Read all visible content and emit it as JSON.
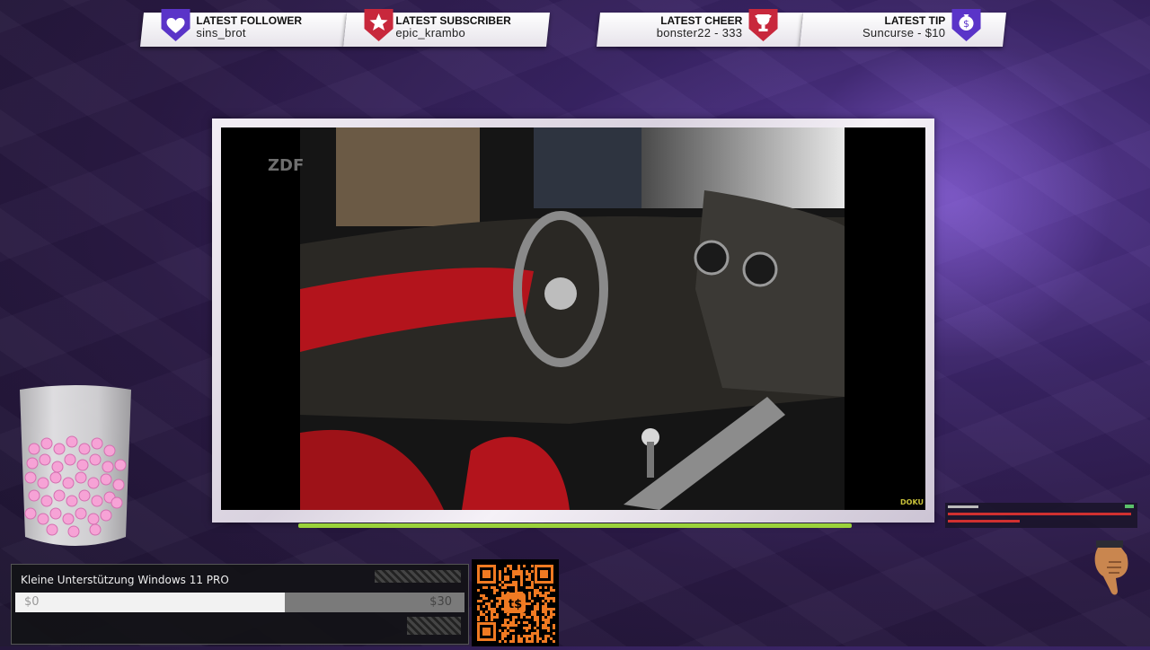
{
  "alerts": {
    "follower": {
      "title": "LATEST FOLLOWER",
      "value": "sins_brot",
      "icon": "heart-icon",
      "color": "#5a34c8"
    },
    "subscriber": {
      "title": "LATEST SUBSCRIBER",
      "value": "epic_krambo",
      "icon": "star-icon",
      "color": "#c8283c"
    },
    "cheer": {
      "title": "LATEST CHEER",
      "value": "bonster22 - 333",
      "icon": "trophy-icon",
      "color": "#c8283c"
    },
    "tip": {
      "title": "LATEST TIP",
      "value": "Suncurse - $10",
      "icon": "money-bag-icon",
      "color": "#5a34c8"
    }
  },
  "video": {
    "channel_logo": "ZDF",
    "corner_tag": "DOKU"
  },
  "goal": {
    "title": "Kleine Unterstützung Windows 11 PRO",
    "start": "$0",
    "end": "$30",
    "progress": 0.6
  },
  "qr": {
    "label": "t$"
  }
}
